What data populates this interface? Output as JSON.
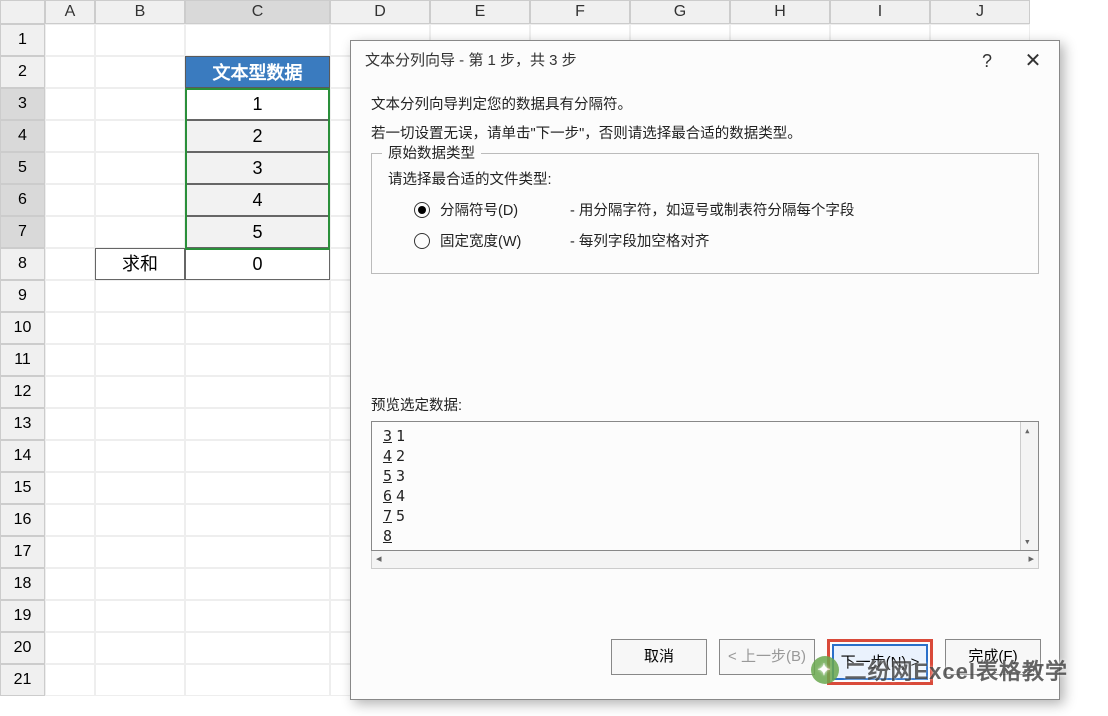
{
  "columns": [
    "A",
    "B",
    "C",
    "D",
    "E",
    "F",
    "G",
    "H",
    "I",
    "J"
  ],
  "row_count": 21,
  "selected_rows": [
    3,
    4,
    5,
    6,
    7
  ],
  "table": {
    "header": "文本型数据",
    "values": [
      "1",
      "2",
      "3",
      "4",
      "5"
    ],
    "sum_label": "求和",
    "sum_value": "0"
  },
  "dialog": {
    "title": "文本分列向导 - 第 1 步，共 3 步",
    "help": "?",
    "close": "✕",
    "intro1": "文本分列向导判定您的数据具有分隔符。",
    "intro2": "若一切设置无误，请单击\"下一步\"，否则请选择最合适的数据类型。",
    "fieldset_legend": "原始数据类型",
    "fieldset_text": "请选择最合适的文件类型:",
    "radio_delim_label": "分隔符号(D)",
    "radio_delim_desc": "- 用分隔字符，如逗号或制表符分隔每个字段",
    "radio_fixed_label": "固定宽度(W)",
    "radio_fixed_desc": "- 每列字段加空格对齐",
    "preview_label": "预览选定数据:",
    "preview_rows": [
      {
        "n": "3",
        "v": "1"
      },
      {
        "n": "4",
        "v": "2"
      },
      {
        "n": "5",
        "v": "3"
      },
      {
        "n": "6",
        "v": "4"
      },
      {
        "n": "7",
        "v": "5"
      },
      {
        "n": "8",
        "v": ""
      }
    ],
    "btn_cancel": "取消",
    "btn_back": "< 上一步(B)",
    "btn_next": "下一步(N) >",
    "btn_finish": "完成(F)"
  },
  "watermark": "二纷网Excel表格教学"
}
